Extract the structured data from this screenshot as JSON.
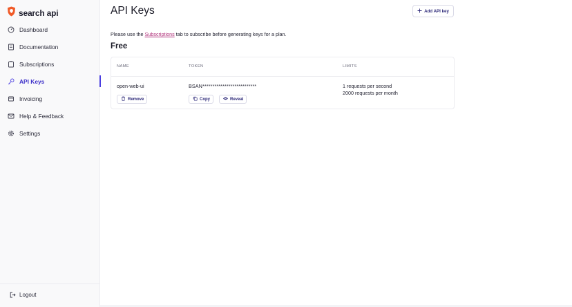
{
  "brand": {
    "name": "search api",
    "logo_icon": "lion-shield-icon",
    "logo_color": "#f05a28"
  },
  "sidebar": {
    "items": [
      {
        "label": "Dashboard",
        "icon": "dashboard-icon"
      },
      {
        "label": "Documentation",
        "icon": "book-icon"
      },
      {
        "label": "Subscriptions",
        "icon": "clipboard-icon"
      },
      {
        "label": "API Keys",
        "icon": "key-icon",
        "active": true
      },
      {
        "label": "Invoicing",
        "icon": "invoice-icon"
      },
      {
        "label": "Help & Feedback",
        "icon": "mail-icon"
      },
      {
        "label": "Settings",
        "icon": "gear-icon"
      }
    ],
    "logout_label": "Logout"
  },
  "header": {
    "title": "API Keys",
    "add_button_label": "Add API key"
  },
  "notice": {
    "before": "Please use the ",
    "link": "Subscriptions",
    "after": " tab to subscribe before generating keys for a plan."
  },
  "plan": {
    "title": "Free"
  },
  "table": {
    "columns": [
      "NAME",
      "TOKEN",
      "LIMITS"
    ],
    "rows": [
      {
        "name": "open-web-ui",
        "token": "BSAN***************************",
        "limits": [
          "1 requests per second",
          "2000 requests per month"
        ],
        "remove_label": "Remove",
        "copy_label": "Copy",
        "reveal_label": "Reveal"
      }
    ]
  },
  "colors": {
    "accent": "#4a3ee0",
    "link": "#b0307a",
    "button_text": "#2e2a7a"
  }
}
